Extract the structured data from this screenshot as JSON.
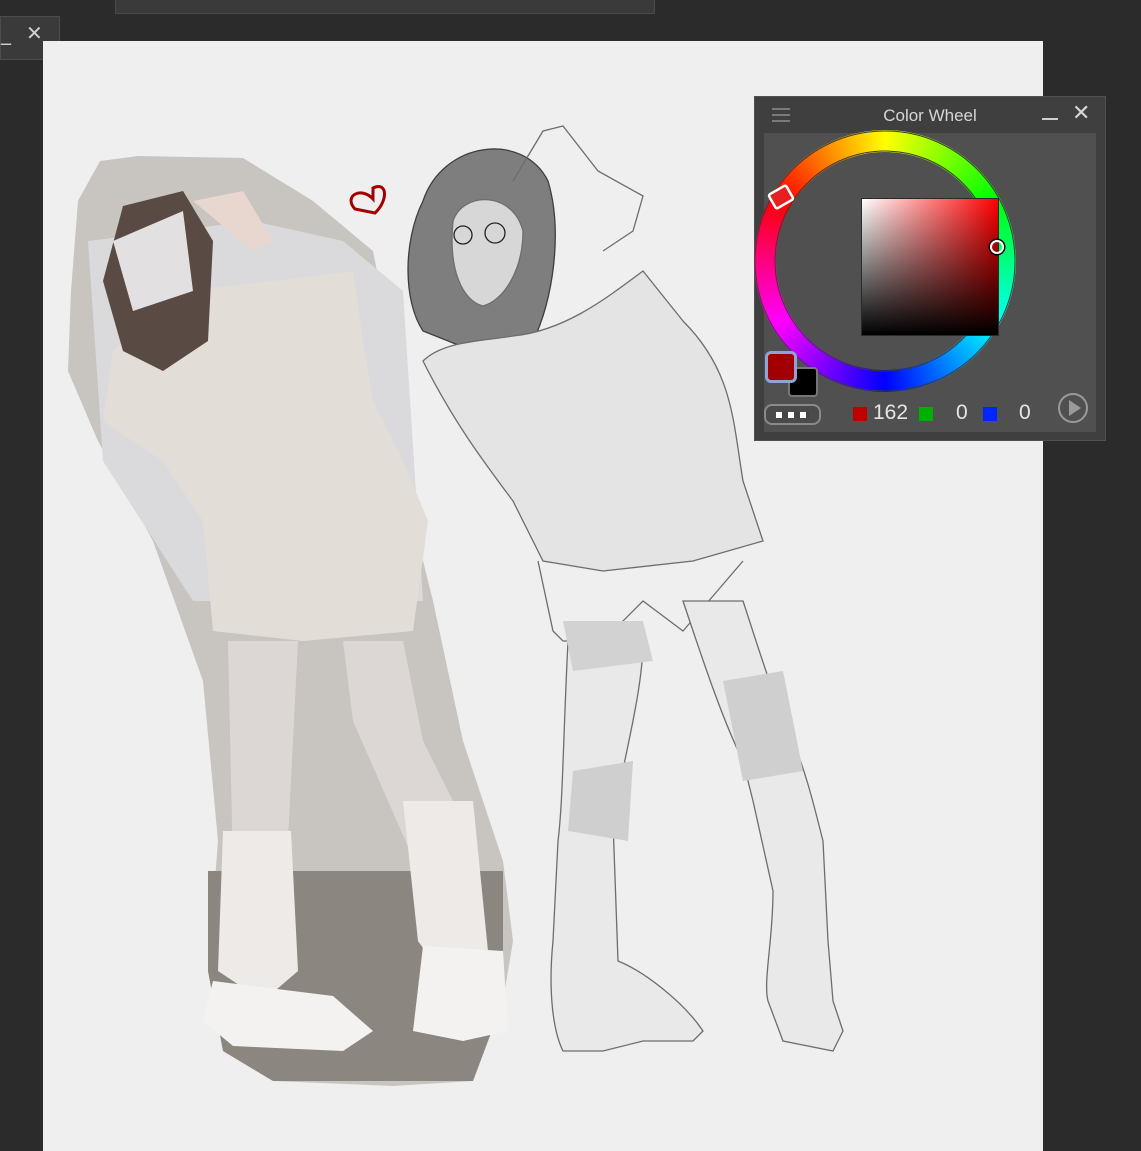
{
  "app": {
    "mini_panel": {
      "minimize_label": "_",
      "close_label": "✕"
    }
  },
  "color_wheel": {
    "title": "Color Wheel",
    "close_label": "✕",
    "foreground_color": "#a20000",
    "background_color": "#000000",
    "hue_degrees": 0,
    "rgb": {
      "r": "162",
      "g": "0",
      "b": "0"
    },
    "channel_colors": {
      "r": "#c00000",
      "g": "#00b000",
      "b": "#0026ff"
    }
  },
  "canvas": {
    "heart_color": "#a30000",
    "paper_color": "#efefef"
  }
}
